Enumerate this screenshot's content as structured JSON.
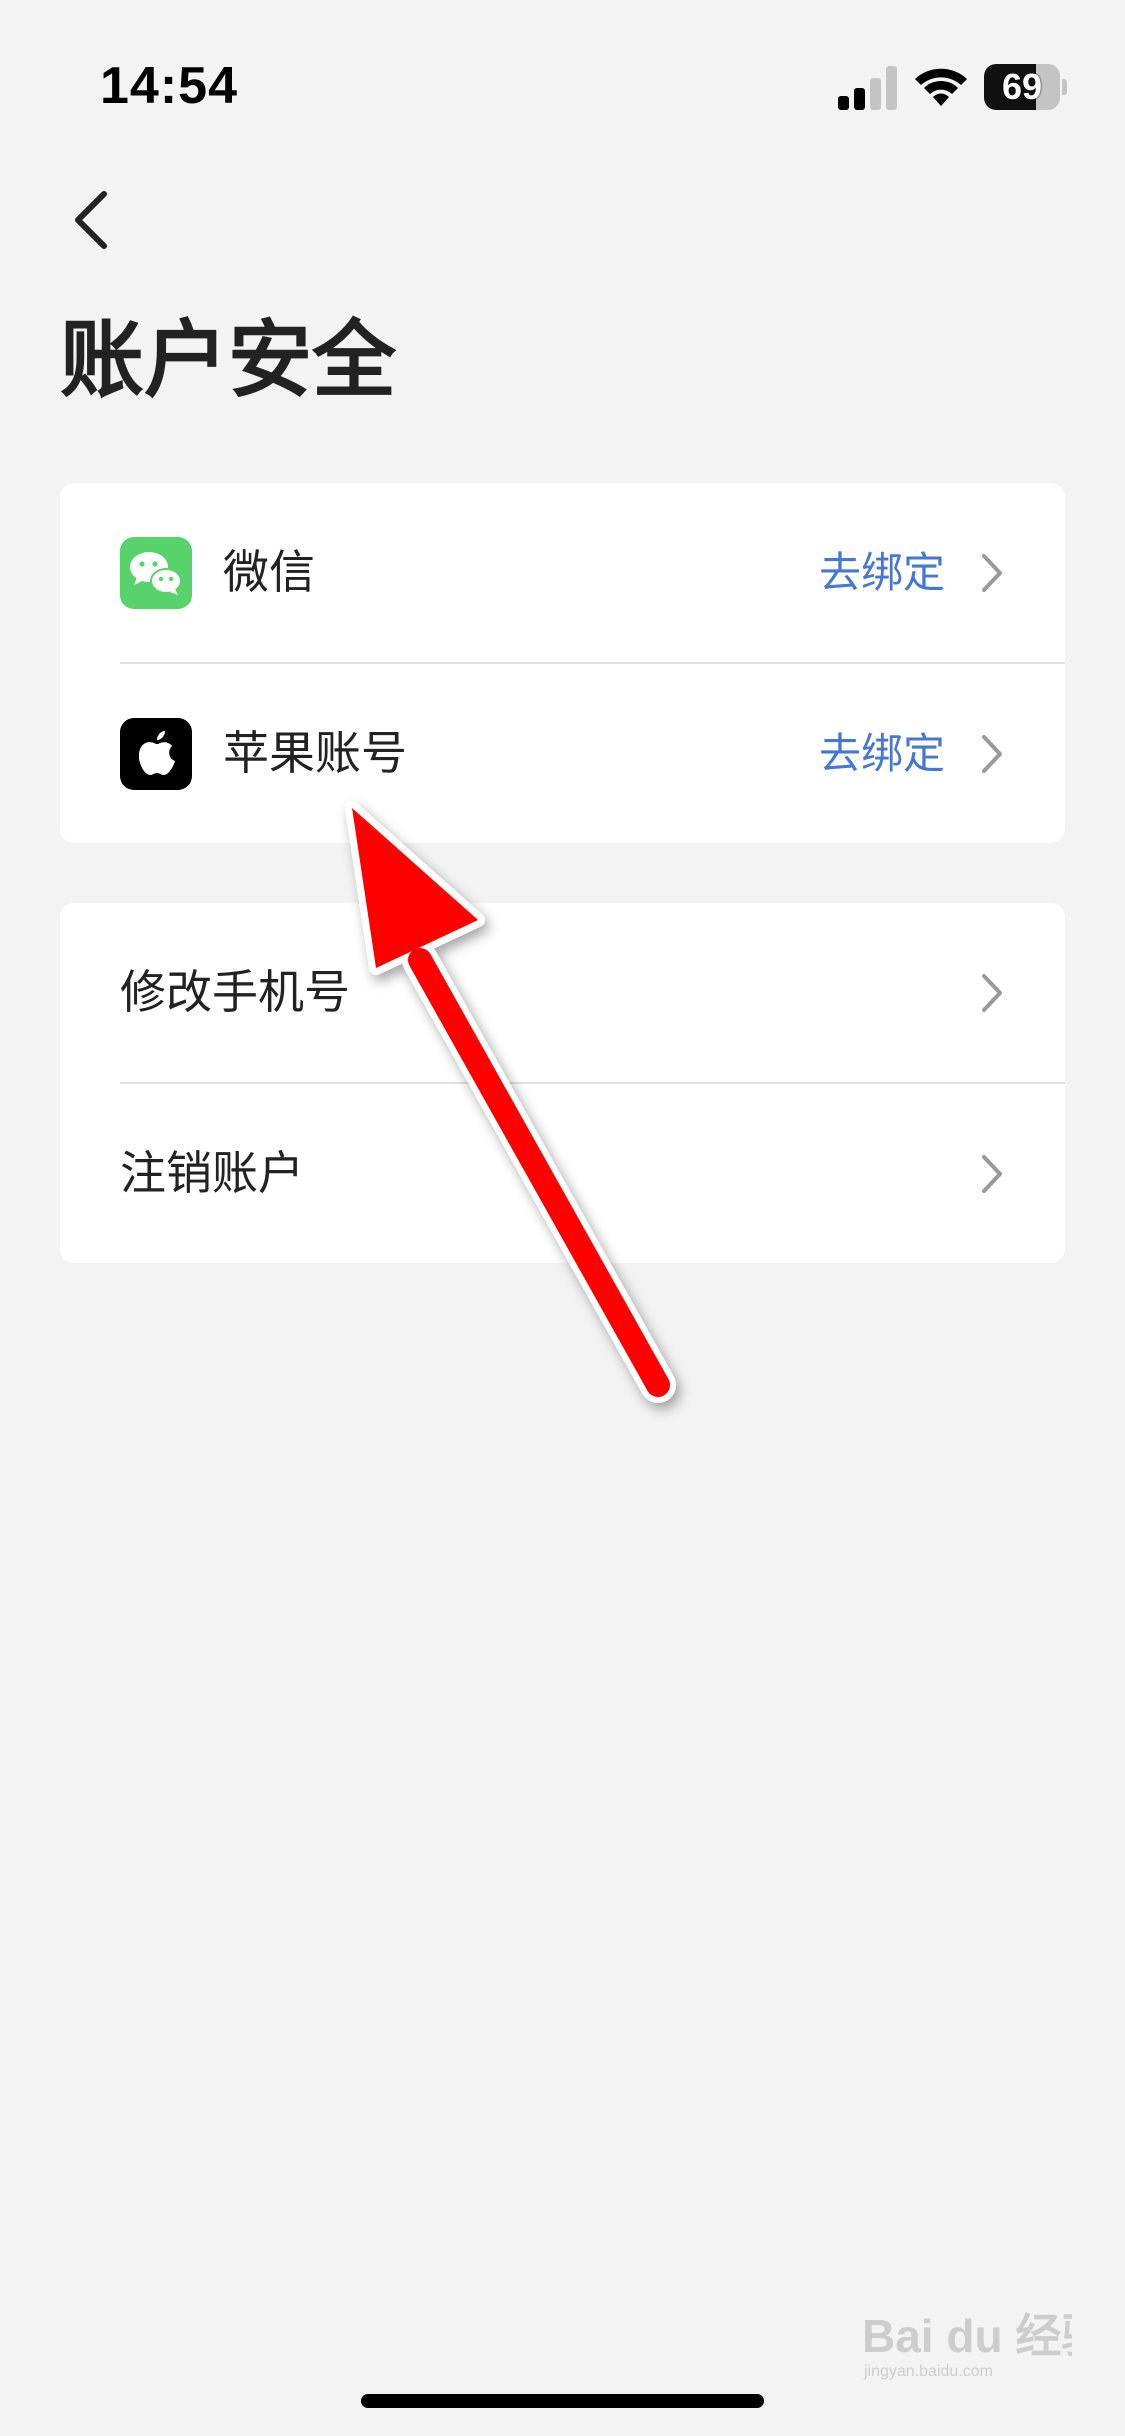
{
  "status_bar": {
    "time": "14:54",
    "battery_level": "69",
    "battery_fraction": 0.69
  },
  "header": {
    "title": "账户安全"
  },
  "linked_accounts": [
    {
      "label": "微信",
      "action": "去绑定",
      "icon": "wechat-icon",
      "icon_color": "#58d26b"
    },
    {
      "label": "苹果账号",
      "action": "去绑定",
      "icon": "apple-icon",
      "icon_color": "#000000"
    }
  ],
  "account_actions": [
    {
      "label": "修改手机号"
    },
    {
      "label": "注销账户"
    }
  ],
  "colors": {
    "background": "#f3f3f3",
    "card": "#ffffff",
    "link": "#4777d1",
    "annotation_arrow": "#ff0000"
  },
  "watermark": {
    "text": "Bai du 经验",
    "subtext": "jingyan.baidu.com"
  }
}
